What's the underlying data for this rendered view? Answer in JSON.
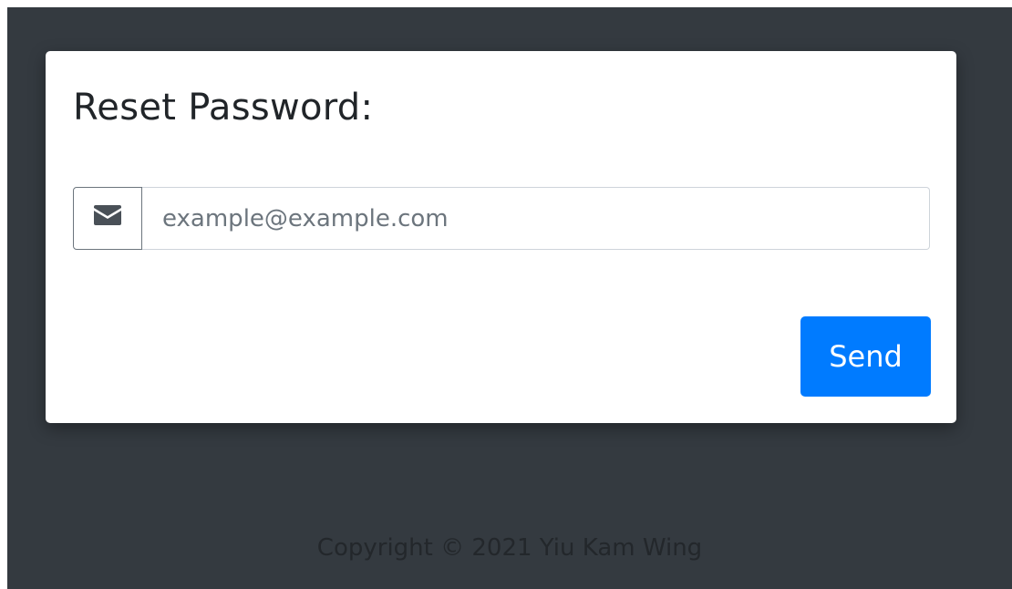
{
  "form": {
    "title": "Reset Password:",
    "email_placeholder": "example@example.com",
    "email_value": "",
    "send_label": "Send",
    "email_icon": "envelope-icon"
  },
  "footer": {
    "copyright": "Copyright © 2021 Yiu Kam Wing"
  },
  "colors": {
    "background": "#343a40",
    "card": "#ffffff",
    "primary_button": "#007bff",
    "footer_text": "#23272b"
  }
}
